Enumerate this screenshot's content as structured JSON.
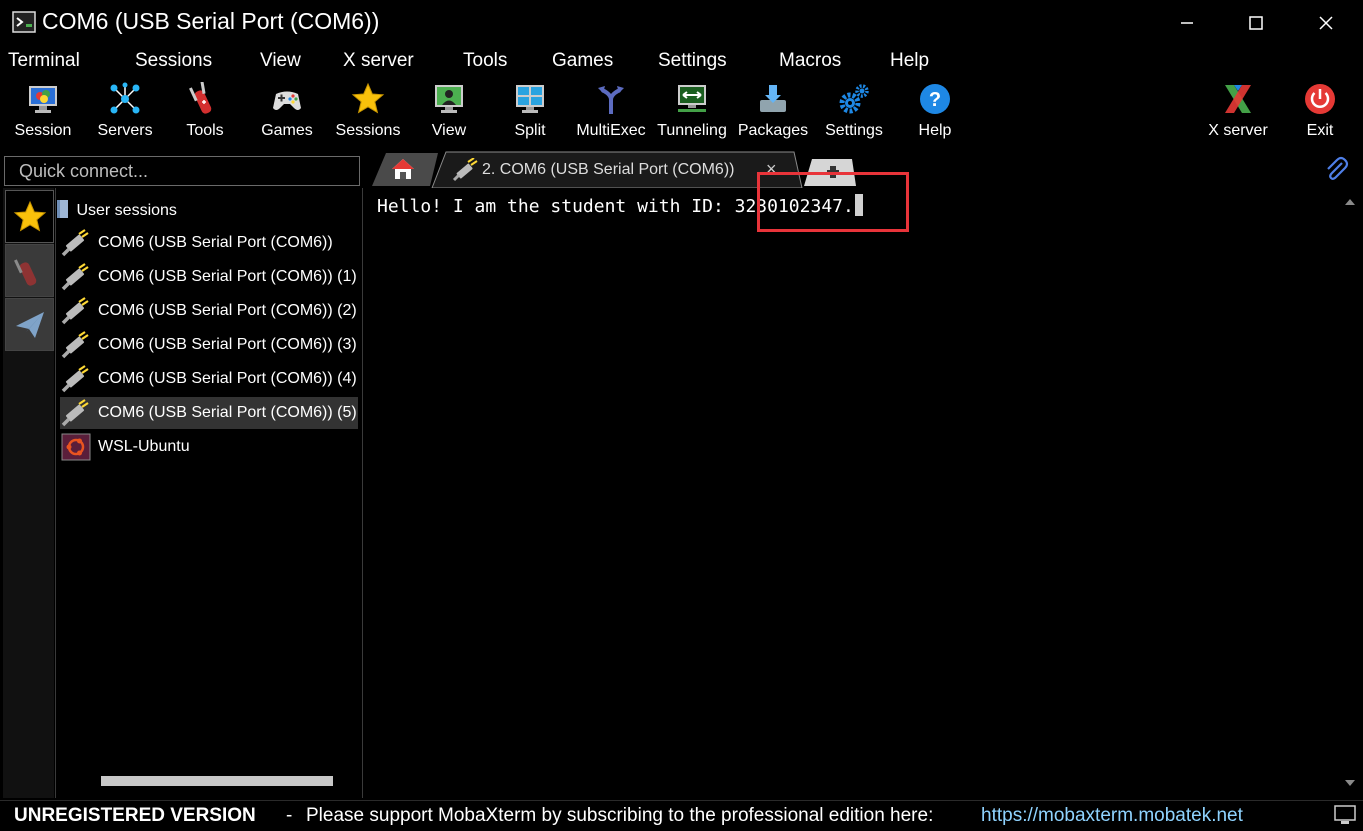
{
  "window": {
    "title": "COM6  (USB Serial Port (COM6))"
  },
  "menu": [
    "Terminal",
    "Sessions",
    "View",
    "X server",
    "Tools",
    "Games",
    "Settings",
    "Macros",
    "Help"
  ],
  "toolbar": {
    "session": "Session",
    "servers": "Servers",
    "tools": "Tools",
    "games": "Games",
    "sessions": "Sessions",
    "view": "View",
    "split": "Split",
    "multiexec": "MultiExec",
    "tunneling": "Tunneling",
    "packages": "Packages",
    "settings": "Settings",
    "help": "Help",
    "xserver": "X server",
    "exit": "Exit"
  },
  "quick_connect": {
    "placeholder": "Quick connect..."
  },
  "tabs": {
    "active_label": "2. COM6  (USB Serial Port (COM6))",
    "close_glyph": "×"
  },
  "sessions_tree": {
    "header": "User sessions",
    "items": [
      "COM6  (USB Serial Port (COM6))",
      "COM6  (USB Serial Port (COM6)) (1)",
      "COM6  (USB Serial Port (COM6)) (2)",
      "COM6  (USB Serial Port (COM6)) (3)",
      "COM6  (USB Serial Port (COM6)) (4)",
      "COM6  (USB Serial Port (COM6)) (5)",
      "WSL-Ubuntu"
    ]
  },
  "terminal": {
    "output": "Hello! I am the student with ID: 3230102347."
  },
  "status": {
    "unregistered": "UNREGISTERED VERSION",
    "separator": "-",
    "message": "Please support MobaXterm by subscribing to the professional edition here:",
    "link": "https://mobaxterm.mobatek.net"
  },
  "colors": {
    "highlight_box": "#e8343a",
    "link": "#8fd3ff",
    "exit_red": "#e53935",
    "help_blue": "#1e88e5"
  }
}
